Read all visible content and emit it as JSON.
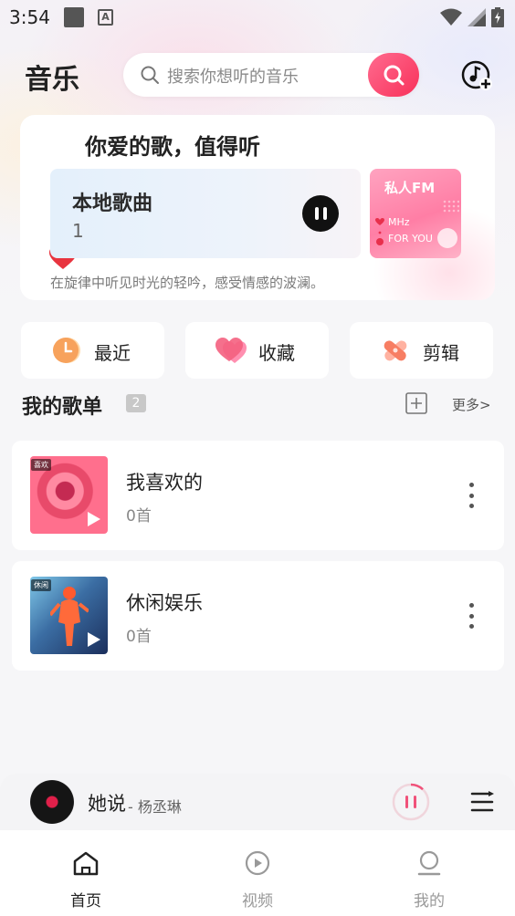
{
  "status_bar": {
    "time": "3:54"
  },
  "header": {
    "title": "音乐",
    "search_placeholder": "搜索你想听的音乐"
  },
  "hero": {
    "title": "你爱的歌，值得听",
    "local_songs": {
      "label": "本地歌曲",
      "count": "1"
    },
    "fm": {
      "title": "私人FM",
      "line1": "MHz",
      "line2": "FOR YOU"
    },
    "caption": "在旋律中听见时光的轻吟，感受情感的波澜。"
  },
  "quick_actions": [
    {
      "label": "最近",
      "icon": "clock-icon"
    },
    {
      "label": "收藏",
      "icon": "hearts-icon"
    },
    {
      "label": "剪辑",
      "icon": "bandage-icon"
    }
  ],
  "playlists_section": {
    "title": "我的歌单",
    "count": "2",
    "more_label": "更多>"
  },
  "playlists": [
    {
      "tag": "喜欢",
      "name": "我喜欢的",
      "count": "0首"
    },
    {
      "tag": "休闲",
      "name": "休闲娱乐",
      "count": "0首"
    }
  ],
  "now_playing": {
    "title": "她说",
    "artist": " - 杨丞琳",
    "progress": 0.12
  },
  "bottom_nav": [
    {
      "label": "首页",
      "icon": "home-icon",
      "active": true
    },
    {
      "label": "视频",
      "icon": "video-icon",
      "active": false
    },
    {
      "label": "我的",
      "icon": "profile-icon",
      "active": false
    }
  ],
  "colors": {
    "accent": "#f8315a",
    "background": "#f6f6f8"
  }
}
